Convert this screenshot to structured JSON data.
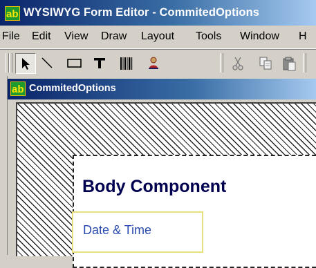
{
  "window": {
    "title": "WYSIWYG Form Editor - CommitedOptions"
  },
  "menu": [
    {
      "label": "File"
    },
    {
      "label": "Edit"
    },
    {
      "label": "View"
    },
    {
      "label": "Draw"
    },
    {
      "label": "Layout"
    },
    {
      "label": "Tools"
    },
    {
      "label": "Window"
    },
    {
      "label": "H"
    }
  ],
  "toolbar": {
    "tools": [
      "select-arrow",
      "line",
      "rectangle",
      "text",
      "barcode",
      "image",
      "cut",
      "copy",
      "paste"
    ]
  },
  "document": {
    "title": "CommitedOptions",
    "body_component_title": "Body Component",
    "field_label": "Date & Time"
  },
  "colors": {
    "title_bar_start": "#0a246a",
    "title_bar_end": "#a6caf0",
    "body_title": "#000050",
    "field_text": "#2a4ab0",
    "field_border": "#e6e080"
  }
}
